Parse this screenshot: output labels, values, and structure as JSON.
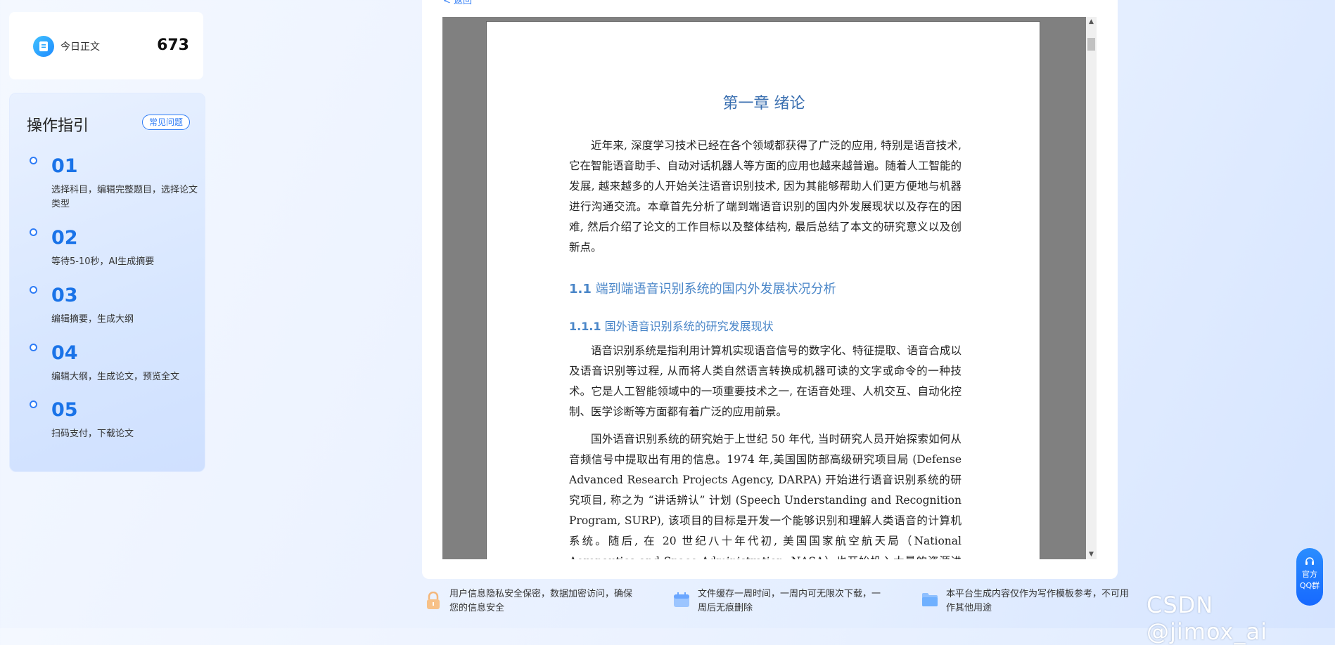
{
  "stats": {
    "label": "今日正文",
    "value": "673"
  },
  "guide": {
    "title": "操作指引",
    "faq_label": "常见问题",
    "steps": [
      {
        "num": "01",
        "desc": "选择科目，编辑完整题目，选择论文类型"
      },
      {
        "num": "02",
        "desc": "等待5-10秒，AI生成摘要"
      },
      {
        "num": "03",
        "desc": "编辑摘要，生成大纲"
      },
      {
        "num": "04",
        "desc": "编辑大纲，生成论文，预览全文"
      },
      {
        "num": "05",
        "desc": "扫码支付，下载论文"
      }
    ]
  },
  "main": {
    "back_label": "< 返回"
  },
  "document": {
    "chapter_title": "第一章 绪论",
    "para1": "近年来, 深度学习技术已经在各个领域都获得了广泛的应用, 特别是语音技术, 它在智能语音助手、自动对话机器人等方面的应用也越来越普遍。随着人工智能的发展, 越来越多的人开始关注语音识别技术, 因为其能够帮助人们更方便地与机器进行沟通交流。本章首先分析了端到端语音识别的国内外发展现状以及存在的困难, 然后介绍了论文的工作目标以及整体结构, 最后总结了本文的研究意义以及创新点。",
    "h2_num": "1.1",
    "h2_text": "端到端语音识别系统的国内外发展状况分析",
    "h3_num": "1.1.1",
    "h3_text": "国外语音识别系统的研究发展现状",
    "para2": "语音识别系统是指利用计算机实现语音信号的数字化、特征提取、语音合成以及语音识别等过程, 从而将人类自然语言转换成机器可读的文字或命令的一种技术。它是人工智能领域中的一项重要技术之一, 在语音处理、人机交互、自动化控制、医学诊断等方面都有着广泛的应用前景。",
    "para3": "国外语音识别系统的研究始于上世纪 50 年代, 当时研究人员开始探索如何从音频信号中提取出有用的信息。1974 年,美国国防部高级研究项目局 (Defense Advanced Research Projects Agency, DARPA) 开始进行语音识别系统的研究项目, 称之为 “讲话辨认” 计划 (Speech Understanding and Recognition Program, SURP), 该项目的目标是开发一个能够识别和理解人类语音的计算机系统。随后, 在 20 世纪八十年代初, 美国国家航空航天局（National Aeronautics and Space Administration, NASA）也开始投入大量的资源进行语音识别系统"
  },
  "notes": [
    {
      "text": "用户信息隐私安全保密，数据加密访问，确保您的信息安全",
      "icon": "lock-icon"
    },
    {
      "text": "文件缓存一周时间，一周内可无限次下载，一周后无痕删除",
      "icon": "calendar-icon"
    },
    {
      "text": "本平台生成内容仅作为写作模板参考，不可用作其他用途",
      "icon": "folder-icon"
    }
  ],
  "qq": {
    "line1": "官方",
    "line2": "QQ群"
  },
  "watermark": "CSDN @jimox_ai",
  "colors": {
    "accent": "#2f7cf6",
    "heading": "#4a86c8",
    "viewer_bg": "#808080"
  }
}
